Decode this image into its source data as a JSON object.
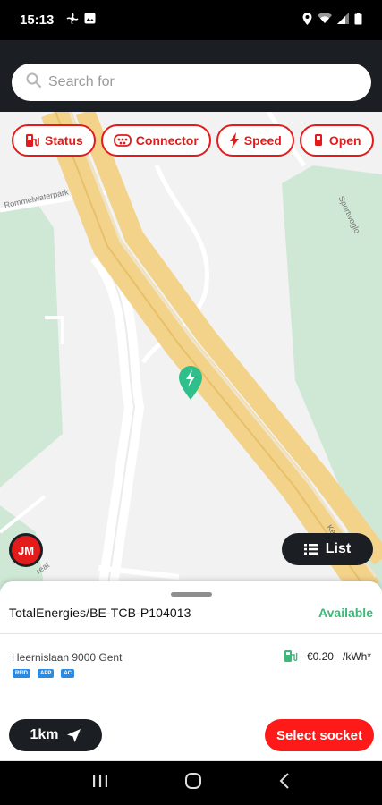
{
  "status_bar": {
    "time": "15:13",
    "icons": [
      "fan-icon",
      "gallery-icon",
      "location-icon",
      "wifi-icon",
      "signal-icon",
      "battery-icon"
    ]
  },
  "search": {
    "placeholder": "Search for"
  },
  "filters": [
    {
      "label": "Status",
      "icon": "charger-status-icon"
    },
    {
      "label": "Connector",
      "icon": "connector-icon"
    },
    {
      "label": "Speed",
      "icon": "lightning-icon"
    },
    {
      "label": "Open",
      "icon": "open-icon"
    }
  ],
  "map": {
    "labels": {
      "park": "Rommelwaterpark",
      "street_right": "Sportweglo",
      "street_top": "Lieve",
      "street_bottom_left": "reat",
      "street_bottom_right": "Ke"
    },
    "marker": "charging-station-marker"
  },
  "user": {
    "initials": "JM"
  },
  "list_button": {
    "label": "List"
  },
  "station": {
    "name": "TotalEnergies/BE-TCB-P104013",
    "status": "Available",
    "address": "Heernislaan 9000 Gent",
    "price": "€0.20",
    "unit": "/kWh*",
    "tags": [
      "RFID",
      "APP",
      "AC"
    ]
  },
  "actions": {
    "distance": "1km",
    "select": "Select socket"
  },
  "colors": {
    "accent": "#e31b1b",
    "available": "#3cb878",
    "dark": "#1b1f23",
    "marker": "#2fbf8b"
  }
}
